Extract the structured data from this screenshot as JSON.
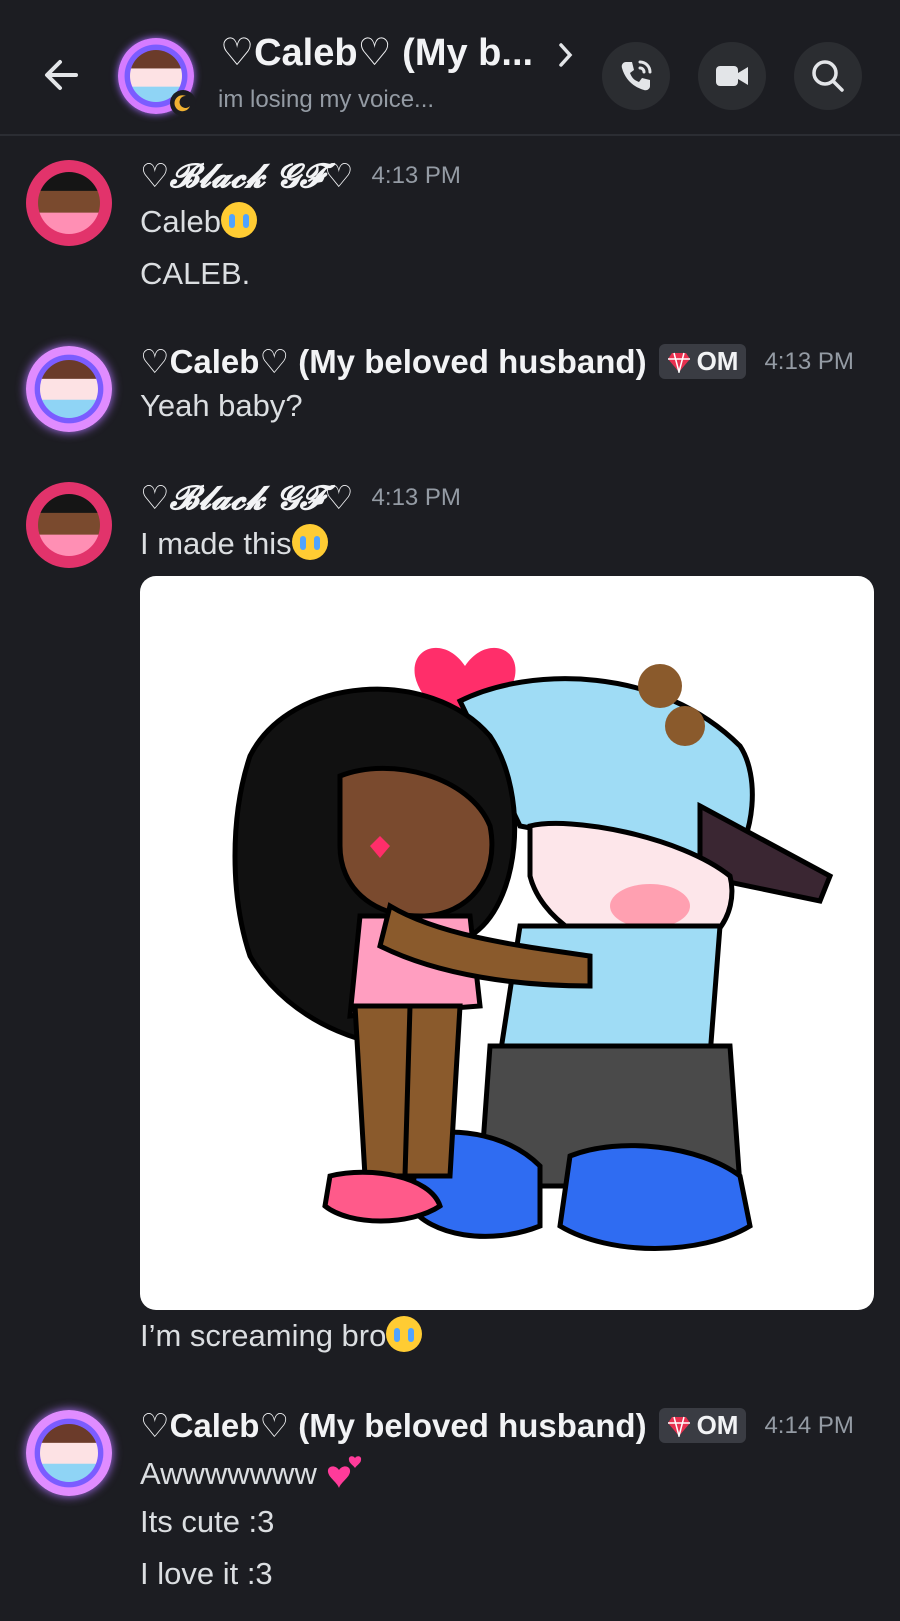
{
  "header": {
    "title": "♡Caleb♡ (My b...",
    "status": "im losing my voice..."
  },
  "messages": [
    {
      "author": "♡𝓑𝓵𝓪𝓬𝓴 𝓖𝓕♡",
      "time": "4:13 PM",
      "lines": [
        "Caleb",
        "CALEB."
      ]
    },
    {
      "author": "♡Caleb♡ (My beloved husband)",
      "badge": "OM",
      "time": "4:13 PM",
      "lines": [
        "Yeah baby?"
      ]
    },
    {
      "author": "♡𝓑𝓵𝓪𝓬𝓴 𝓖𝓕♡",
      "time": "4:13 PM",
      "lines": [
        "I made this",
        "I’m screaming bro"
      ]
    },
    {
      "author": "♡Caleb♡ (My beloved husband)",
      "badge": "OM",
      "time": "4:14 PM",
      "lines": [
        "Awwwwwww",
        "Its cute :3",
        "I love it :3"
      ]
    }
  ],
  "icons": {
    "back": "arrow-left-icon",
    "call": "phone-call-icon",
    "video": "video-camera-icon",
    "search": "search-icon",
    "badge": "gem-icon",
    "crying": "crying-emoji",
    "hearts": "two-hearts-emoji"
  },
  "colors": {
    "background": "#1c1d22",
    "text": "#dbdee1",
    "muted": "#949ba4",
    "gem": "#e8304f"
  }
}
